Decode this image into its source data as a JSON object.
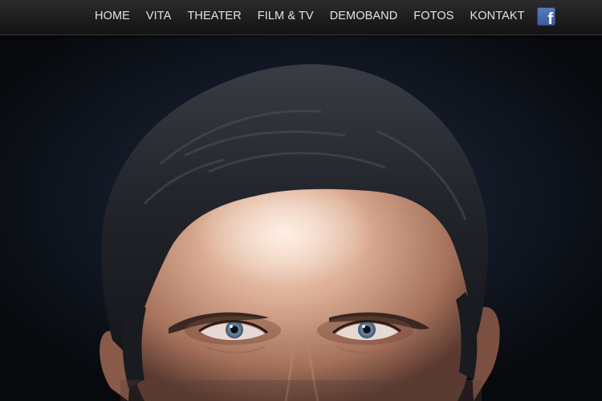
{
  "nav": {
    "items": [
      {
        "label": "HOME"
      },
      {
        "label": "VITA"
      },
      {
        "label": "THEATER"
      },
      {
        "label": "FILM & TV"
      },
      {
        "label": "DEMOBAND"
      },
      {
        "label": "FOTOS"
      },
      {
        "label": "KONTAKT"
      }
    ],
    "social": {
      "icon": "facebook-icon",
      "glyph": "f",
      "color": "#3b5a9c"
    }
  },
  "hero": {
    "image": "portrait-photo",
    "background_color": "#0e1117"
  }
}
